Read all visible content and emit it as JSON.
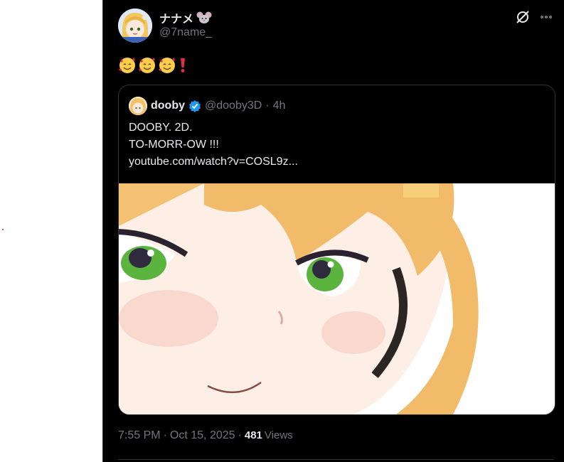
{
  "post": {
    "author": {
      "display_name": "ナナメ",
      "handle": "@7name_",
      "name_emoji": "mouse-face"
    },
    "emojis": [
      "smiling-face-with-hearts",
      "smiling-face-with-hearts",
      "smiling-face-with-hearts",
      "red-exclamation-mark"
    ],
    "quoted": {
      "author": {
        "display_name": "dooby",
        "handle": "@dooby3D",
        "verified": true
      },
      "separator": "·",
      "age": "4h",
      "lines": [
        "DOOBY. 2D.",
        "TO-MORR-OW !!!",
        "youtube.com/watch?v=COSL9z..."
      ],
      "media": {
        "description_icon": "anime-character-face-closeup"
      }
    },
    "time": "7:55 PM",
    "meta_separator": "·",
    "date": "Oct 15, 2025",
    "views_separator": "·",
    "views_count": "481",
    "views_label": "Views"
  },
  "colors": {
    "background": "#000000",
    "text": "#e7e9ea",
    "muted": "#71767b",
    "verified": "#1d9bf0",
    "border": "#2f3336"
  }
}
